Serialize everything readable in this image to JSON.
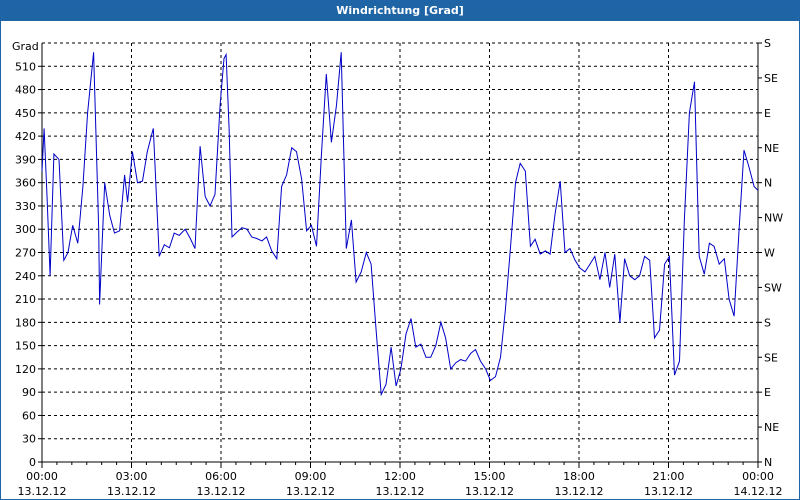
{
  "window": {
    "title": "Windrichtung [Grad]"
  },
  "colors": {
    "titlebar": "#1f65a6",
    "series": "#0000c8",
    "grid": "#000000"
  },
  "chart_data": {
    "type": "line",
    "title": "Windrichtung [Grad]",
    "ylabel": "Grad",
    "xlabel": "",
    "grid": true,
    "ylim": [
      0,
      540
    ],
    "y_ticks": [
      0,
      30,
      60,
      90,
      120,
      150,
      180,
      210,
      240,
      270,
      300,
      330,
      360,
      390,
      420,
      450,
      480,
      510
    ],
    "y2_ticks": [
      {
        "value": 0,
        "label": "N"
      },
      {
        "value": 45,
        "label": "NE"
      },
      {
        "value": 90,
        "label": "E"
      },
      {
        "value": 135,
        "label": "SE"
      },
      {
        "value": 180,
        "label": "S"
      },
      {
        "value": 225,
        "label": "SW"
      },
      {
        "value": 270,
        "label": "W"
      },
      {
        "value": 315,
        "label": "NW"
      },
      {
        "value": 360,
        "label": "N"
      },
      {
        "value": 405,
        "label": "NE"
      },
      {
        "value": 450,
        "label": "E"
      },
      {
        "value": 495,
        "label": "SE"
      },
      {
        "value": 540,
        "label": "S"
      }
    ],
    "xlim": [
      0,
      24
    ],
    "x_ticks": [
      {
        "value": 0,
        "time": "00:00",
        "date": "13.12.12"
      },
      {
        "value": 3,
        "time": "03:00",
        "date": "13.12.12"
      },
      {
        "value": 6,
        "time": "06:00",
        "date": "13.12.12"
      },
      {
        "value": 9,
        "time": "09:00",
        "date": "13.12.12"
      },
      {
        "value": 12,
        "time": "12:00",
        "date": "13.12.12"
      },
      {
        "value": 15,
        "time": "15:00",
        "date": "13.12.12"
      },
      {
        "value": 18,
        "time": "18:00",
        "date": "13.12.12"
      },
      {
        "value": 21,
        "time": "21:00",
        "date": "13.12.12"
      },
      {
        "value": 24,
        "time": "00:00",
        "date": "14.12.12"
      }
    ],
    "x_minor_ticks": [
      0.5,
      1,
      1.5,
      2,
      2.5,
      3.5,
      4,
      4.5,
      5,
      5.5,
      6.5,
      7,
      7.5,
      8,
      8.5,
      9.5,
      10,
      10.5,
      11,
      11.5,
      12.5,
      13,
      13.5,
      14,
      14.5,
      15.5,
      16,
      16.5,
      17,
      17.5,
      18.5,
      19,
      19.5,
      20,
      20.5,
      21.5,
      22,
      22.5,
      23,
      23.5
    ],
    "series": [
      {
        "points": [
          [
            0.0,
            375
          ],
          [
            0.07,
            430
          ],
          [
            0.17,
            340
          ],
          [
            0.27,
            240
          ],
          [
            0.4,
            397
          ],
          [
            0.57,
            390
          ],
          [
            0.73,
            260
          ],
          [
            0.87,
            270
          ],
          [
            1.03,
            305
          ],
          [
            1.2,
            282
          ],
          [
            1.37,
            355
          ],
          [
            1.53,
            450
          ],
          [
            1.73,
            528
          ],
          [
            1.9,
            300
          ],
          [
            1.93,
            203
          ],
          [
            2.1,
            360
          ],
          [
            2.27,
            318
          ],
          [
            2.43,
            295
          ],
          [
            2.6,
            298
          ],
          [
            2.77,
            370
          ],
          [
            2.87,
            335
          ],
          [
            3.03,
            400
          ],
          [
            3.2,
            360
          ],
          [
            3.37,
            362
          ],
          [
            3.53,
            400
          ],
          [
            3.73,
            430
          ],
          [
            3.93,
            265
          ],
          [
            4.1,
            280
          ],
          [
            4.27,
            276
          ],
          [
            4.43,
            295
          ],
          [
            4.6,
            292
          ],
          [
            4.8,
            300
          ],
          [
            4.97,
            288
          ],
          [
            5.13,
            275
          ],
          [
            5.3,
            407
          ],
          [
            5.47,
            342
          ],
          [
            5.63,
            330
          ],
          [
            5.8,
            345
          ],
          [
            5.97,
            460
          ],
          [
            6.1,
            520
          ],
          [
            6.17,
            525
          ],
          [
            6.27,
            430
          ],
          [
            6.37,
            290
          ],
          [
            6.53,
            296
          ],
          [
            6.7,
            302
          ],
          [
            6.87,
            300
          ],
          [
            7.03,
            290
          ],
          [
            7.2,
            288
          ],
          [
            7.37,
            285
          ],
          [
            7.53,
            290
          ],
          [
            7.7,
            272
          ],
          [
            7.87,
            262
          ],
          [
            8.03,
            355
          ],
          [
            8.2,
            370
          ],
          [
            8.37,
            405
          ],
          [
            8.53,
            400
          ],
          [
            8.7,
            365
          ],
          [
            8.87,
            298
          ],
          [
            9.03,
            305
          ],
          [
            9.2,
            278
          ],
          [
            9.37,
            398
          ],
          [
            9.53,
            500
          ],
          [
            9.7,
            412
          ],
          [
            9.87,
            460
          ],
          [
            10.03,
            528
          ],
          [
            10.2,
            275
          ],
          [
            10.37,
            312
          ],
          [
            10.53,
            232
          ],
          [
            10.7,
            245
          ],
          [
            10.87,
            270
          ],
          [
            11.03,
            255
          ],
          [
            11.2,
            170
          ],
          [
            11.37,
            87
          ],
          [
            11.53,
            100
          ],
          [
            11.7,
            148
          ],
          [
            11.87,
            98
          ],
          [
            12.03,
            120
          ],
          [
            12.2,
            165
          ],
          [
            12.37,
            185
          ],
          [
            12.53,
            148
          ],
          [
            12.7,
            152
          ],
          [
            12.87,
            135
          ],
          [
            13.03,
            135
          ],
          [
            13.2,
            150
          ],
          [
            13.37,
            180
          ],
          [
            13.53,
            160
          ],
          [
            13.7,
            120
          ],
          [
            13.87,
            128
          ],
          [
            14.03,
            132
          ],
          [
            14.2,
            130
          ],
          [
            14.37,
            140
          ],
          [
            14.53,
            145
          ],
          [
            14.7,
            130
          ],
          [
            14.87,
            120
          ],
          [
            15.03,
            105
          ],
          [
            15.2,
            110
          ],
          [
            15.37,
            135
          ],
          [
            15.53,
            195
          ],
          [
            15.7,
            275
          ],
          [
            15.87,
            360
          ],
          [
            16.03,
            385
          ],
          [
            16.2,
            375
          ],
          [
            16.37,
            278
          ],
          [
            16.53,
            287
          ],
          [
            16.7,
            268
          ],
          [
            16.87,
            272
          ],
          [
            17.03,
            268
          ],
          [
            17.2,
            320
          ],
          [
            17.37,
            362
          ],
          [
            17.53,
            270
          ],
          [
            17.7,
            275
          ],
          [
            17.87,
            260
          ],
          [
            18.03,
            250
          ],
          [
            18.2,
            245
          ],
          [
            18.37,
            255
          ],
          [
            18.53,
            265
          ],
          [
            18.7,
            235
          ],
          [
            18.87,
            270
          ],
          [
            19.03,
            225
          ],
          [
            19.2,
            268
          ],
          [
            19.37,
            180
          ],
          [
            19.53,
            262
          ],
          [
            19.7,
            240
          ],
          [
            19.87,
            235
          ],
          [
            20.03,
            240
          ],
          [
            20.2,
            265
          ],
          [
            20.37,
            260
          ],
          [
            20.53,
            160
          ],
          [
            20.7,
            170
          ],
          [
            20.87,
            255
          ],
          [
            21.03,
            265
          ],
          [
            21.2,
            112
          ],
          [
            21.37,
            130
          ],
          [
            21.53,
            310
          ],
          [
            21.7,
            450
          ],
          [
            21.87,
            490
          ],
          [
            22.03,
            265
          ],
          [
            22.2,
            242
          ],
          [
            22.37,
            282
          ],
          [
            22.53,
            278
          ],
          [
            22.7,
            255
          ],
          [
            22.87,
            262
          ],
          [
            23.03,
            210
          ],
          [
            23.2,
            188
          ],
          [
            23.37,
            302
          ],
          [
            23.53,
            402
          ],
          [
            23.7,
            380
          ],
          [
            23.87,
            355
          ],
          [
            24.0,
            350
          ]
        ]
      }
    ]
  }
}
